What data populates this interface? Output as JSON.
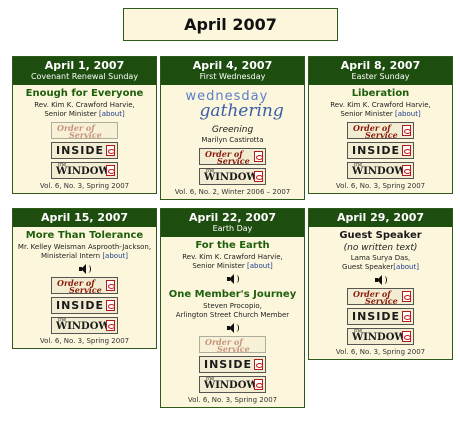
{
  "page_title": "April 2007",
  "buttons": {
    "order_line1": "Order of",
    "order_line2": "Service",
    "inside": "INSIDE",
    "window_the": "the",
    "window": "WINDOW"
  },
  "cards": {
    "apr1": {
      "date": "April 1, 2007",
      "subtitle": "Covenant Renewal Sunday",
      "sermon": "Enough for Everyone",
      "speaker_line1": "Rev. Kim K. Crawford Harvie,",
      "speaker_line2": "Senior Minister",
      "about": "[about]",
      "volume": "Vol. 6, No. 3, Spring 2007"
    },
    "apr4": {
      "date": "April 4, 2007",
      "subtitle": "First Wednesday",
      "logo_top": "wednesday",
      "logo_bottom": "gathering",
      "sermon": "Greening",
      "speaker": "Marilyn Castirotta",
      "volume": "Vol. 6, No. 2, Winter 2006 – 2007"
    },
    "apr8": {
      "date": "April 8, 2007",
      "subtitle": "Easter Sunday",
      "sermon": "Liberation",
      "speaker_line1": "Rev. Kim K. Crawford Harvie,",
      "speaker_line2": "Senior Minister",
      "about": "[about]",
      "volume": "Vol. 6, No. 3, Spring 2007"
    },
    "apr15": {
      "date": "April 15, 2007",
      "sermon": "More Than Tolerance",
      "speaker_line1": "Mr. Kelley Weisman Asprooth-Jackson,",
      "speaker_line2": "Ministerial Intern",
      "about": "[about]",
      "volume": "Vol. 6, No. 3, Spring 2007"
    },
    "apr22": {
      "date": "April 22, 2007",
      "subtitle": "Earth Day",
      "sermon": "For the Earth",
      "speaker_line1": "Rev. Kim K. Crawford Harvie,",
      "speaker_line2": "Senior Minister",
      "about": "[about]",
      "sermon2": "One Member's Journey",
      "speaker2_line1": "Steven Procopio,",
      "speaker2_line2": "Arlington Street Church Member",
      "volume": "Vol. 6, No. 3, Spring 2007"
    },
    "apr29": {
      "date": "April 29, 2007",
      "sermon": "Guest Speaker",
      "note": "(no written text)",
      "speaker_line1": "Lama Surya Das,",
      "speaker_line2": "Guest Speaker",
      "about": "[about]",
      "volume": "Vol. 6, No. 3, Spring 2007"
    }
  }
}
